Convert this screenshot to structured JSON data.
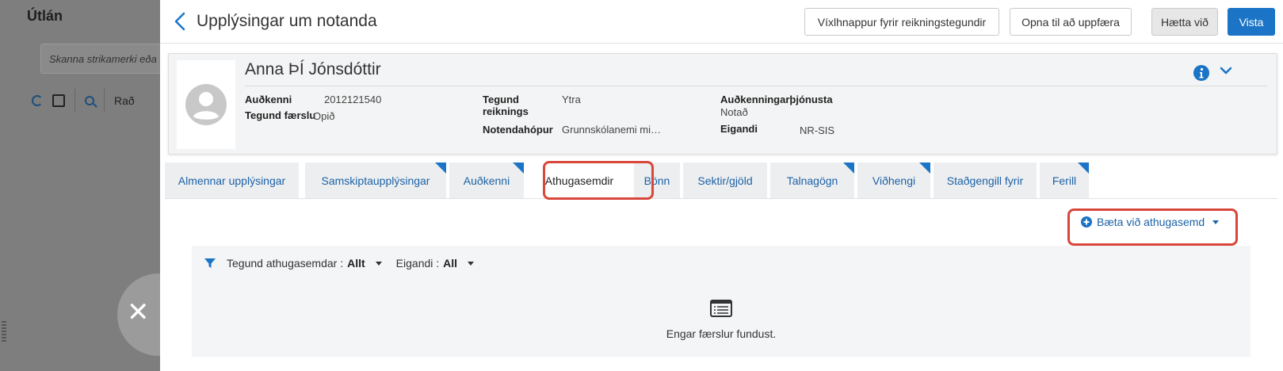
{
  "background": {
    "title": "Útlán",
    "scan_placeholder": "Skanna strikamerki eða",
    "toolbar_label": "Rað"
  },
  "header": {
    "title": "Upplýsingar um notanda",
    "btn_toggle": "Víxlhnappur fyrir reikningstegundir",
    "btn_open": "Opna til að uppfæra",
    "btn_cancel": "Hætta við",
    "btn_save": "Vista"
  },
  "user": {
    "name": "Anna ÞÍ Jónsdóttir",
    "fields": {
      "id_label": "Auðkenni",
      "id_value": "2012121540",
      "record_type_label": "Tegund færslu",
      "record_type_value": "Opið",
      "account_type_label": "Tegund reiknings",
      "account_type_value": "Ytra",
      "user_group_label": "Notendahópur",
      "user_group_value": "Grunnskólanemi mi…",
      "auth_service_label": "Auðkenningarþjónusta",
      "auth_service_value": "Notað",
      "owner_label": "Eigandi",
      "owner_value": "NR-SIS"
    }
  },
  "tabs": [
    {
      "label": "Almennar upplýsingar",
      "active": false,
      "corner": false
    },
    {
      "label": "Samskiptaupplýsingar",
      "active": false,
      "corner": true
    },
    {
      "label": "Auðkenni",
      "active": false,
      "corner": true
    },
    {
      "label": "Athugasemdir",
      "active": true,
      "corner": false
    },
    {
      "label": "Bönn",
      "active": false,
      "corner": false
    },
    {
      "label": "Sektir/gjöld",
      "active": false,
      "corner": false
    },
    {
      "label": "Talnagögn",
      "active": false,
      "corner": true
    },
    {
      "label": "Viðhengi",
      "active": false,
      "corner": true
    },
    {
      "label": "Staðgengill fyrir",
      "active": false,
      "corner": false
    },
    {
      "label": "Ferill",
      "active": false,
      "corner": true
    }
  ],
  "notes": {
    "add_label": "Bæta við athugasemd",
    "filter_type_label": "Tegund athugasemdar :",
    "filter_type_value": "Allt",
    "filter_owner_label": "Eigandi :",
    "filter_owner_value": "All",
    "empty_text": "Engar færslur fundust."
  },
  "colors": {
    "accent": "#1b74c5",
    "link": "#1d62a6",
    "highlight": "#d8473a"
  }
}
